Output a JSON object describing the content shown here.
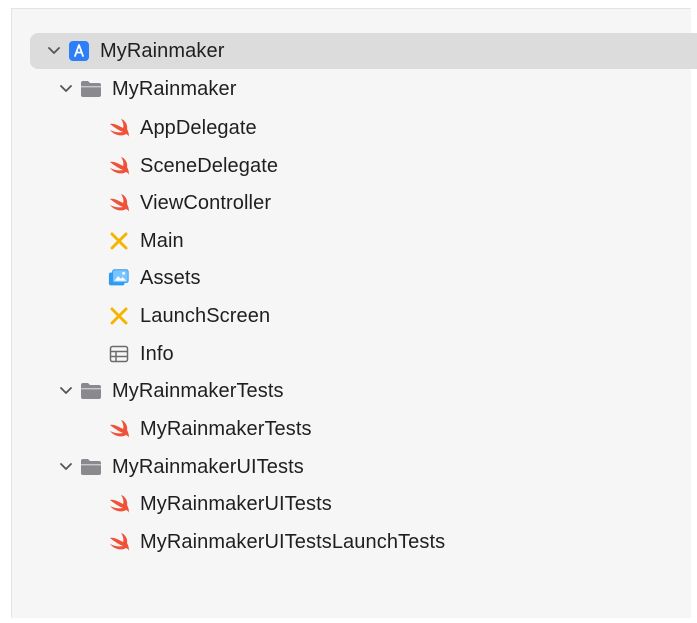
{
  "tree": {
    "project": {
      "label": "MyRainmaker",
      "icon": "xcode-project-icon"
    },
    "groups": [
      {
        "label": "MyRainmaker",
        "icon": "folder-icon",
        "files": [
          {
            "label": "AppDelegate",
            "icon": "swift-icon"
          },
          {
            "label": "SceneDelegate",
            "icon": "swift-icon"
          },
          {
            "label": "ViewController",
            "icon": "swift-icon"
          },
          {
            "label": "Main",
            "icon": "storyboard-icon"
          },
          {
            "label": "Assets",
            "icon": "asset-catalog-icon"
          },
          {
            "label": "LaunchScreen",
            "icon": "storyboard-icon"
          },
          {
            "label": "Info",
            "icon": "plist-icon"
          }
        ]
      },
      {
        "label": "MyRainmakerTests",
        "icon": "folder-icon",
        "files": [
          {
            "label": "MyRainmakerTests",
            "icon": "swift-icon"
          }
        ]
      },
      {
        "label": "MyRainmakerUITests",
        "icon": "folder-icon",
        "files": [
          {
            "label": "MyRainmakerUITests",
            "icon": "swift-icon"
          },
          {
            "label": "MyRainmakerUITestsLaunchTests",
            "icon": "swift-icon"
          }
        ]
      }
    ]
  },
  "colors": {
    "swift": "#f05138",
    "storyboard": "#f5b400",
    "assets": "#2f9bf0",
    "project": "#2d7ff9",
    "folder": "#8a8a8e",
    "selection": "#dcdcdc"
  }
}
